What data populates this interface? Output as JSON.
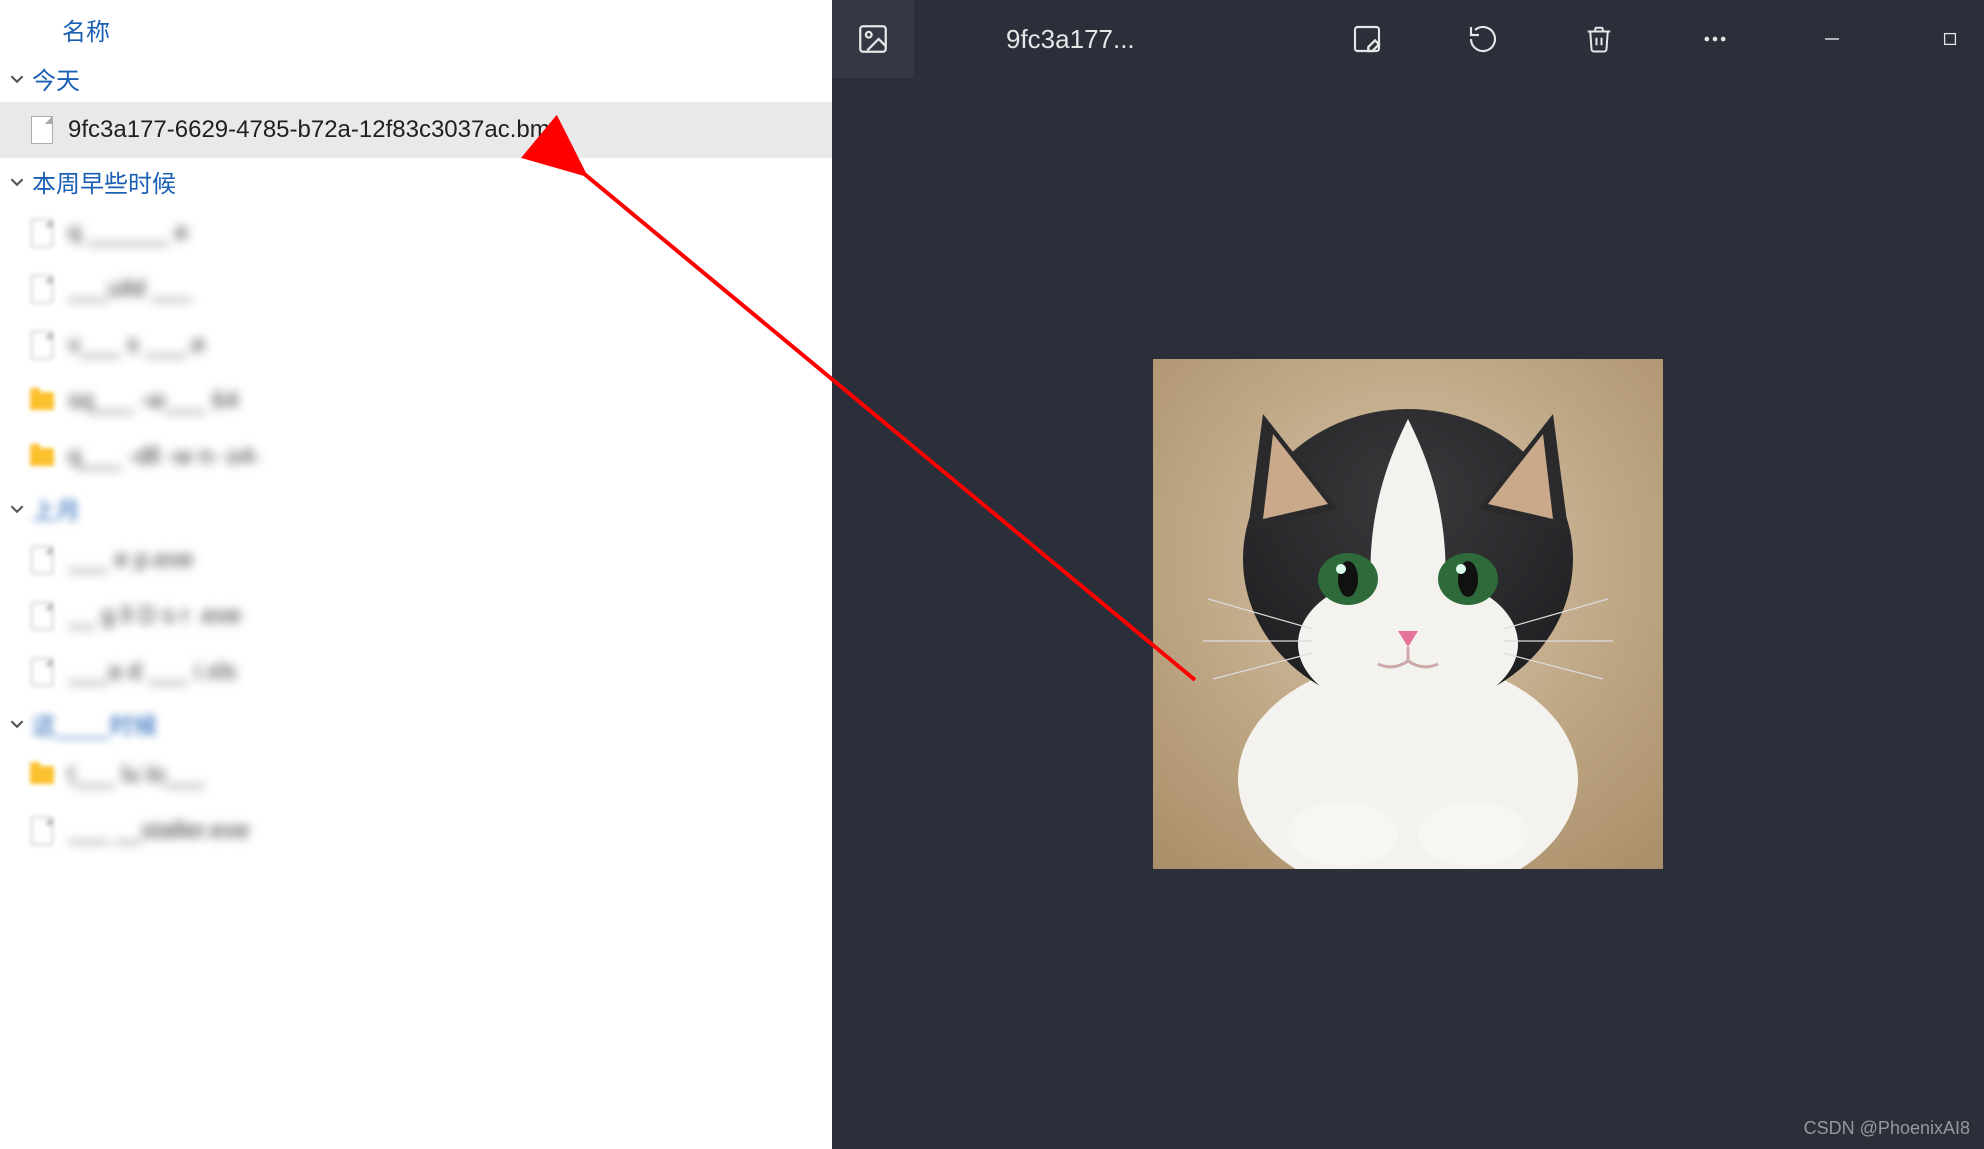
{
  "explorer": {
    "column_header": "名称",
    "groups": [
      {
        "label": "今天",
        "items": [
          {
            "name": "9fc3a177-6629-4785-b72a-12f83c3037ac.bmp",
            "icon": "file",
            "selected": true,
            "blurred": false
          }
        ]
      },
      {
        "label": "本周早些时候",
        "items": [
          {
            "name": "q ______ e",
            "icon": "file",
            "blurred": true
          },
          {
            "name": "___uild ___",
            "icon": "file",
            "blurred": true
          },
          {
            "name": "v___ s ___.e",
            "icon": "file",
            "blurred": true
          },
          {
            "name": "sq___  -w___ 64",
            "icon": "folder",
            "blurred": true
          },
          {
            "name": "q___ -dll -w n-  o4-",
            "icon": "folder",
            "blurred": true
          }
        ]
      },
      {
        "label": "上月",
        "blurred_label": true,
        "items": [
          {
            "name": "___  e   p.exe",
            "icon": "file",
            "blurred": true
          },
          {
            "name": "__ g  ll  D s r  .exe",
            "icon": "file",
            "blurred": true
          },
          {
            "name": "___a  d ___ i.xls",
            "icon": "file",
            "blurred": true
          }
        ]
      },
      {
        "label": "这____时候",
        "blurred_label": true,
        "items": [
          {
            "name": "t___ lu  lo___",
            "icon": "folder",
            "blurred": true
          },
          {
            "name": "___ __staller.exe",
            "icon": "file",
            "blurred": true
          }
        ]
      }
    ]
  },
  "viewer": {
    "title": "9fc3a177...",
    "toolbar_icons": [
      "edit-image-icon",
      "rotate-icon",
      "delete-icon",
      "more-icon"
    ],
    "window_icons": [
      "minimize-icon",
      "maximize-icon"
    ],
    "image_description": "black-and-white tuxedo cat with green eyes sitting, photo preview"
  },
  "watermark": "CSDN @PhoenixAI8"
}
